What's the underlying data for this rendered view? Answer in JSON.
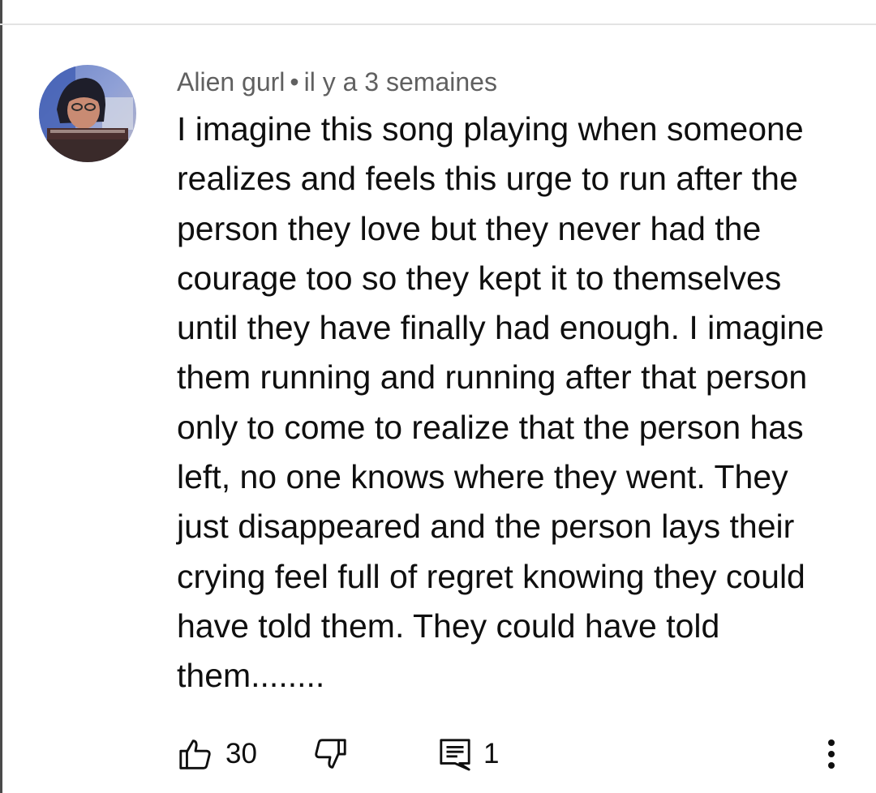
{
  "comment": {
    "author": "Alien gurl",
    "separator": "•",
    "timestamp": "il y a 3 semaines",
    "text": "I imagine this song playing when someone\nrealizes and feels this urge to run after the\nperson they love but they never had the\ncourage too so they kept it to themselves\nuntil they have finally had enough. I imagine\nthem running and running after that person\nonly to come to realize that the person has\nleft, no one knows where they went. They\njust disappeared and the person lays their\ncrying feel full of regret knowing they could\nhave told them. They could have told\nthem........",
    "likes": "30",
    "replies": "1"
  },
  "icons": {
    "like": "thumb-up-icon",
    "dislike": "thumb-down-icon",
    "reply": "comment-reply-icon",
    "more": "more-vert-icon"
  },
  "colors": {
    "meta_text": "#606060",
    "body_text": "#0f0f0f",
    "divider": "#e3e3e3",
    "background": "#ffffff"
  }
}
